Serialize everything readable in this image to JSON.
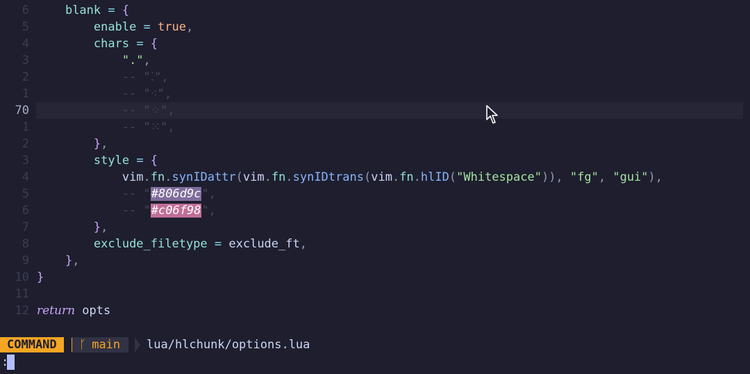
{
  "editor": {
    "lines": [
      {
        "num": "6",
        "current": false,
        "tokens": [
          {
            "t": "    ",
            "c": "id"
          },
          {
            "t": "blank",
            "c": "var"
          },
          {
            "t": " = ",
            "c": "op"
          },
          {
            "t": "{",
            "c": "brace"
          }
        ]
      },
      {
        "num": "5",
        "current": false,
        "tokens": [
          {
            "t": "        ",
            "c": "id"
          },
          {
            "t": "enable",
            "c": "var"
          },
          {
            "t": " = ",
            "c": "op"
          },
          {
            "t": "true",
            "c": "bool"
          },
          {
            "t": ",",
            "c": "punc"
          }
        ]
      },
      {
        "num": "4",
        "current": false,
        "tokens": [
          {
            "t": "        ",
            "c": "id"
          },
          {
            "t": "chars",
            "c": "var"
          },
          {
            "t": " = ",
            "c": "op"
          },
          {
            "t": "{",
            "c": "brace"
          }
        ]
      },
      {
        "num": "3",
        "current": false,
        "tokens": [
          {
            "t": "            ",
            "c": "id"
          },
          {
            "t": "\".\"",
            "c": "str"
          },
          {
            "t": ",",
            "c": "punc"
          }
        ]
      },
      {
        "num": "2",
        "current": false,
        "tokens": [
          {
            "t": "            ",
            "c": "id"
          },
          {
            "t": "-- \"⁚\",",
            "c": "com"
          }
        ]
      },
      {
        "num": "1",
        "current": false,
        "tokens": [
          {
            "t": "            ",
            "c": "id"
          },
          {
            "t": "-- \"⁖\",",
            "c": "com"
          }
        ]
      },
      {
        "num": "70",
        "current": true,
        "tokens": [
          {
            "t": "            ",
            "c": "id"
          },
          {
            "t": "-- \"⁘\",",
            "c": "com"
          }
        ]
      },
      {
        "num": "1",
        "current": false,
        "tokens": [
          {
            "t": "            ",
            "c": "id"
          },
          {
            "t": "-- \"⁙\",",
            "c": "com"
          }
        ]
      },
      {
        "num": "2",
        "current": false,
        "tokens": [
          {
            "t": "        ",
            "c": "id"
          },
          {
            "t": "}",
            "c": "brace"
          },
          {
            "t": ",",
            "c": "punc"
          }
        ]
      },
      {
        "num": "3",
        "current": false,
        "tokens": [
          {
            "t": "        ",
            "c": "id"
          },
          {
            "t": "style",
            "c": "var"
          },
          {
            "t": " = ",
            "c": "op"
          },
          {
            "t": "{",
            "c": "brace"
          }
        ]
      },
      {
        "num": "4",
        "current": false,
        "tokens": [
          {
            "t": "            ",
            "c": "id"
          },
          {
            "t": "vim",
            "c": "id"
          },
          {
            "t": ".",
            "c": "punc"
          },
          {
            "t": "fn",
            "c": "var"
          },
          {
            "t": ".",
            "c": "punc"
          },
          {
            "t": "synIDattr",
            "c": "fn"
          },
          {
            "t": "(",
            "c": "punc"
          },
          {
            "t": "vim",
            "c": "id"
          },
          {
            "t": ".",
            "c": "punc"
          },
          {
            "t": "fn",
            "c": "var"
          },
          {
            "t": ".",
            "c": "punc"
          },
          {
            "t": "synIDtrans",
            "c": "fn"
          },
          {
            "t": "(",
            "c": "punc"
          },
          {
            "t": "vim",
            "c": "id"
          },
          {
            "t": ".",
            "c": "punc"
          },
          {
            "t": "fn",
            "c": "var"
          },
          {
            "t": ".",
            "c": "punc"
          },
          {
            "t": "hlID",
            "c": "fn"
          },
          {
            "t": "(",
            "c": "punc"
          },
          {
            "t": "\"Whitespace\"",
            "c": "str"
          },
          {
            "t": ")), ",
            "c": "punc"
          },
          {
            "t": "\"fg\"",
            "c": "str"
          },
          {
            "t": ", ",
            "c": "punc"
          },
          {
            "t": "\"gui\"",
            "c": "str"
          },
          {
            "t": "),",
            "c": "punc"
          }
        ]
      },
      {
        "num": "5",
        "current": false,
        "tokens": [
          {
            "t": "            ",
            "c": "id"
          },
          {
            "t": "-- \"",
            "c": "com"
          },
          {
            "t": "#806d9c",
            "c": "swatch",
            "bg": "#806d9c"
          },
          {
            "t": "\",",
            "c": "com"
          }
        ]
      },
      {
        "num": "6",
        "current": false,
        "tokens": [
          {
            "t": "            ",
            "c": "id"
          },
          {
            "t": "-- \"",
            "c": "com"
          },
          {
            "t": "#c06f98",
            "c": "swatch",
            "bg": "#c06f98"
          },
          {
            "t": "\",",
            "c": "com"
          }
        ]
      },
      {
        "num": "7",
        "current": false,
        "tokens": [
          {
            "t": "        ",
            "c": "id"
          },
          {
            "t": "}",
            "c": "brace"
          },
          {
            "t": ",",
            "c": "punc"
          }
        ]
      },
      {
        "num": "8",
        "current": false,
        "tokens": [
          {
            "t": "        ",
            "c": "id"
          },
          {
            "t": "exclude_filetype",
            "c": "var"
          },
          {
            "t": " = ",
            "c": "op"
          },
          {
            "t": "exclude_ft",
            "c": "id"
          },
          {
            "t": ",",
            "c": "punc"
          }
        ]
      },
      {
        "num": "9",
        "current": false,
        "tokens": [
          {
            "t": "    ",
            "c": "id"
          },
          {
            "t": "}",
            "c": "brace"
          },
          {
            "t": ",",
            "c": "punc"
          }
        ]
      },
      {
        "num": "10",
        "current": false,
        "tokens": [
          {
            "t": "}",
            "c": "brace"
          }
        ]
      },
      {
        "num": "11",
        "current": false,
        "tokens": []
      },
      {
        "num": "12",
        "current": false,
        "tokens": [
          {
            "t": "return",
            "c": "kw"
          },
          {
            "t": " opts",
            "c": "id"
          }
        ]
      }
    ]
  },
  "statusline": {
    "mode": "COMMAND",
    "branch_icon": "ᚴ",
    "branch": "main",
    "filepath": "lua/hlchunk/options.lua"
  },
  "cmdline": {
    "prompt": ":"
  },
  "colors": {
    "background": "#1e1e2e",
    "mode_bg": "#f5a623",
    "current_line": "#262637"
  }
}
